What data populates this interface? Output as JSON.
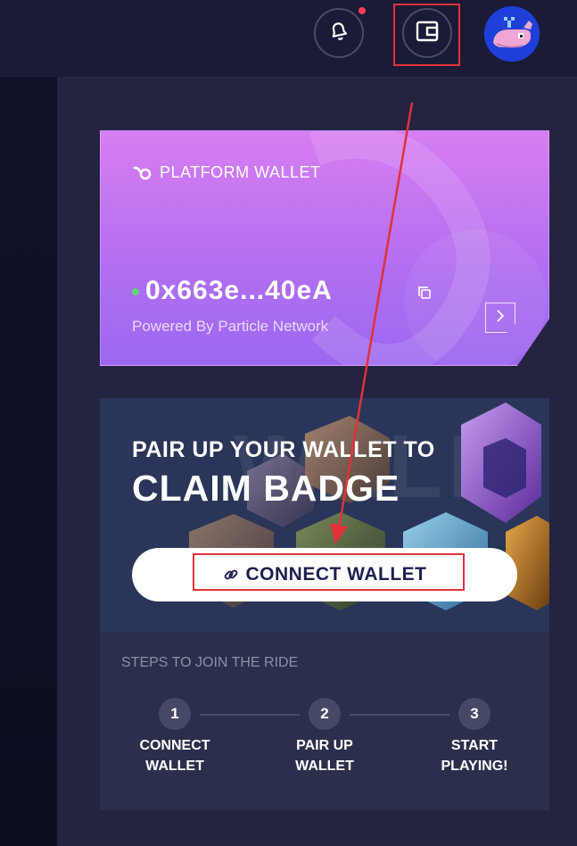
{
  "header": {
    "bell_icon": "bell-icon",
    "wallet_icon": "wallet-icon",
    "avatar_icon": "whale-avatar"
  },
  "platform_wallet": {
    "title": "PLATFORM WALLET",
    "address": "0x663e...40eA",
    "powered_by": "Powered By Particle Network",
    "status_color": "#5dd67a"
  },
  "claim": {
    "line1": "PAIR UP YOUR WALLET TO",
    "line2": "CLAIM BADGE",
    "watermark": "WALL",
    "connect_label": "CONNECT WALLET"
  },
  "steps": {
    "title": "STEPS TO JOIN THE RIDE",
    "items": [
      {
        "num": "1",
        "line1": "CONNECT",
        "line2": "WALLET"
      },
      {
        "num": "2",
        "line1": "PAIR UP",
        "line2": "WALLET"
      },
      {
        "num": "3",
        "line1": "START",
        "line2": "PLAYING!"
      }
    ]
  },
  "colors": {
    "highlight": "#e0323a",
    "card_top": "#d77ef1",
    "card_bottom": "#9b68f0"
  }
}
